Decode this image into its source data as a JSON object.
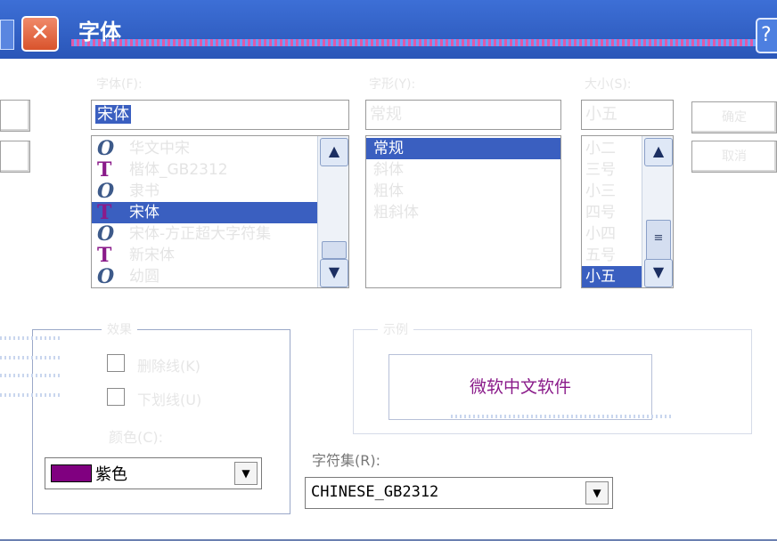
{
  "window": {
    "title": "字体",
    "close_glyph": "✕",
    "help_glyph": "?"
  },
  "font": {
    "label": "字体(F):",
    "value": "宋体",
    "items": [
      {
        "name": "华文中宋",
        "type": "opentype",
        "state": "dim"
      },
      {
        "name": "楷体_GB2312",
        "type": "truetype",
        "state": "dim"
      },
      {
        "name": "隶书",
        "type": "opentype",
        "state": "dim"
      },
      {
        "name": "宋体",
        "type": "truetype",
        "state": "selected"
      },
      {
        "name": "宋体-方正超大字符集",
        "type": "opentype",
        "state": "dim"
      },
      {
        "name": "新宋体",
        "type": "truetype",
        "state": "dim"
      },
      {
        "name": "幼圆",
        "type": "opentype",
        "state": "dim"
      }
    ]
  },
  "style": {
    "label": "字形(Y):",
    "value": "常规",
    "items": [
      {
        "name": "常规",
        "state": "selected"
      },
      {
        "name": "斜体",
        "state": "dim"
      },
      {
        "name": "粗体",
        "state": "dim"
      },
      {
        "name": "粗斜体",
        "state": "dim"
      }
    ]
  },
  "size": {
    "label": "大小(S):",
    "value": "小五",
    "items": [
      {
        "name": "小二",
        "state": "dim"
      },
      {
        "name": "三号",
        "state": "dim"
      },
      {
        "name": "小三",
        "state": "dim"
      },
      {
        "name": "四号",
        "state": "dim"
      },
      {
        "name": "小四",
        "state": "dim"
      },
      {
        "name": "五号",
        "state": "dim"
      },
      {
        "name": "小五",
        "state": "selected"
      }
    ]
  },
  "buttons": {
    "ok": "确定",
    "cancel": "取消"
  },
  "effects": {
    "label": "效果",
    "strikeout": "删除线(K)",
    "underline": "下划线(U)",
    "color_label": "颜色(C):",
    "color_value": "紫色"
  },
  "sample": {
    "label": "示例",
    "text": "微软中文软件"
  },
  "script": {
    "label": "字符集(R):",
    "value": "CHINESE_GB2312"
  },
  "colors": {
    "accent": "#3a5fc0",
    "sample_text": "#8a1b8a",
    "swatch": "#800080"
  },
  "icons": {
    "close": "close-icon",
    "help": "help-icon",
    "up": "arrow-up-icon",
    "down": "arrow-down-icon",
    "dropdown": "dropdown-arrow-icon",
    "opentype": "opentype-font-icon",
    "truetype": "truetype-font-icon"
  },
  "glyphs": {
    "up": "▲",
    "down": "▼",
    "dropdown": "▼",
    "grip": "≡",
    "opentype": "O",
    "truetype": "T"
  }
}
